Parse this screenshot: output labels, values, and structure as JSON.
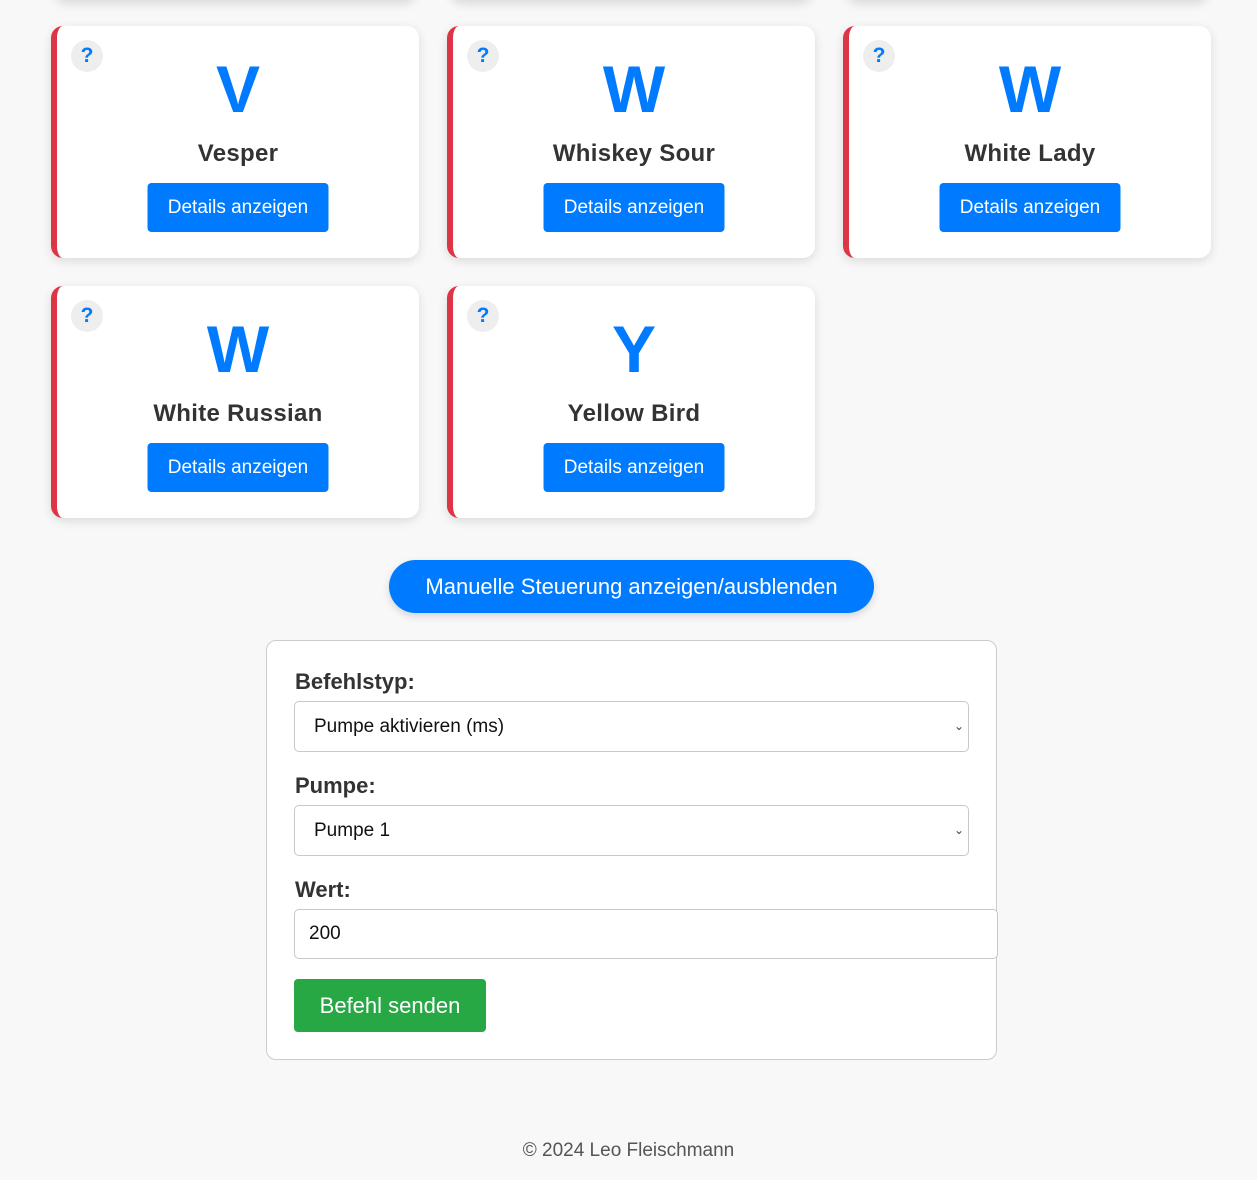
{
  "cards": [
    {
      "letter": "V",
      "name": "Vesper",
      "help": "?",
      "button": "Details anzeigen"
    },
    {
      "letter": "W",
      "name": "Whiskey Sour",
      "help": "?",
      "button": "Details anzeigen"
    },
    {
      "letter": "W",
      "name": "White Lady",
      "help": "?",
      "button": "Details anzeigen"
    },
    {
      "letter": "W",
      "name": "White Russian",
      "help": "?",
      "button": "Details anzeigen"
    },
    {
      "letter": "Y",
      "name": "Yellow Bird",
      "help": "?",
      "button": "Details anzeigen"
    }
  ],
  "manual": {
    "toggle_label": "Manuelle Steuerung anzeigen/ausblenden",
    "command_type_label": "Befehlstyp:",
    "command_type_value": "Pumpe aktivieren (ms)",
    "pump_label": "Pumpe:",
    "pump_value": "Pumpe 1",
    "value_label": "Wert:",
    "value": "200",
    "send_label": "Befehl senden"
  },
  "footer": {
    "text": "© 2024 Leo Fleischmann"
  },
  "colors": {
    "accent": "#007bff",
    "card_border": "#dc3545",
    "send": "#28a745",
    "background": "#f8f8f8"
  }
}
